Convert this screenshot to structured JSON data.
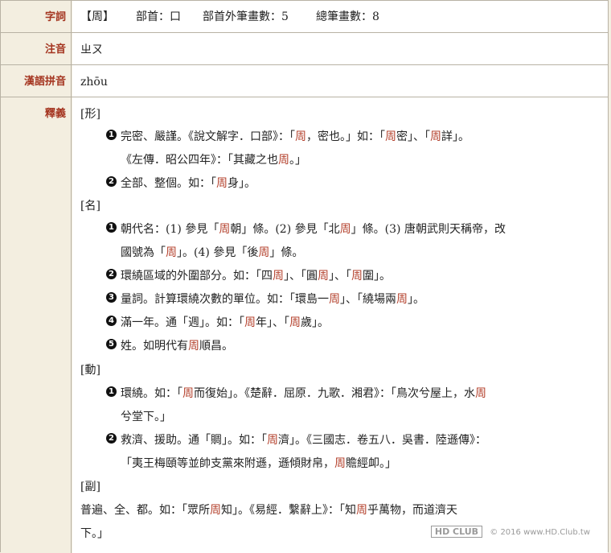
{
  "labels": {
    "char": "字詞",
    "zhuyin": "注音",
    "pinyin": "漢語拼音",
    "meaning": "釋義"
  },
  "char_info": {
    "char": "【周】",
    "radical": "部首：口",
    "strokes_outside": "部首外筆畫數：5",
    "total_strokes": "總筆畫數：8"
  },
  "zhuyin": "ㄓㄡ",
  "pinyin": "zhōu",
  "sections": {
    "adj": "[形]",
    "noun": "[名]",
    "verb": "[動]",
    "adv": "[副]"
  },
  "adj_items": {
    "n1": "1",
    "i1_l1": "完密、嚴謹。《說文解字．口部》：「周，密也。」如：「周密」、「周詳」。",
    "i1_l2": "《左傳．昭公四年》：「其藏之也周。」",
    "n2": "2",
    "i2_l1": "全部、整個。如：「周身」。"
  },
  "noun_items": {
    "n1": "1",
    "i1_l1": "朝代名：(1) 參見「周朝」條。(2) 參見「北周」條。(3) 唐朝武則天稱帝，改",
    "i1_l2": "國號為「周」。(4) 參見「後周」條。",
    "n2": "2",
    "i2_l1": "環繞區域的外圍部分。如：「四周」、「圓周」、「周圍」。",
    "n3": "3",
    "i3_l1": "量詞。計算環繞次數的單位。如：「環島一周」、「繞場兩周」。",
    "n4": "4",
    "i4_l1": "滿一年。通「週」。如：「周年」、「周歲」。",
    "n5": "5",
    "i5_l1": "姓。如明代有周順昌。"
  },
  "verb_items": {
    "n1": "1",
    "i1_l1": "環繞。如：「周而復始」。《楚辭．屈原．九歌．湘君》：「鳥次兮屋上，水周",
    "i1_l2": "兮堂下。」",
    "n2": "2",
    "i2_l1": "救濟、援助。通「賙」。如：「周濟」。《三國志．卷五八．吳書．陸遜傳》：",
    "i2_l2": "「夷王梅頤等並帥支黨來附遜，遜傾財帛，周贍經卹。」"
  },
  "adv_items": {
    "i1_l1": "普遍、全、都。如：「眾所周知」。《易經．繫辭上》：「知周乎萬物，而道濟天",
    "i1_l2": "下。」"
  },
  "watermark": {
    "logo": "HD CLUB",
    "text": "© 2016 www.HD.Club.tw"
  }
}
